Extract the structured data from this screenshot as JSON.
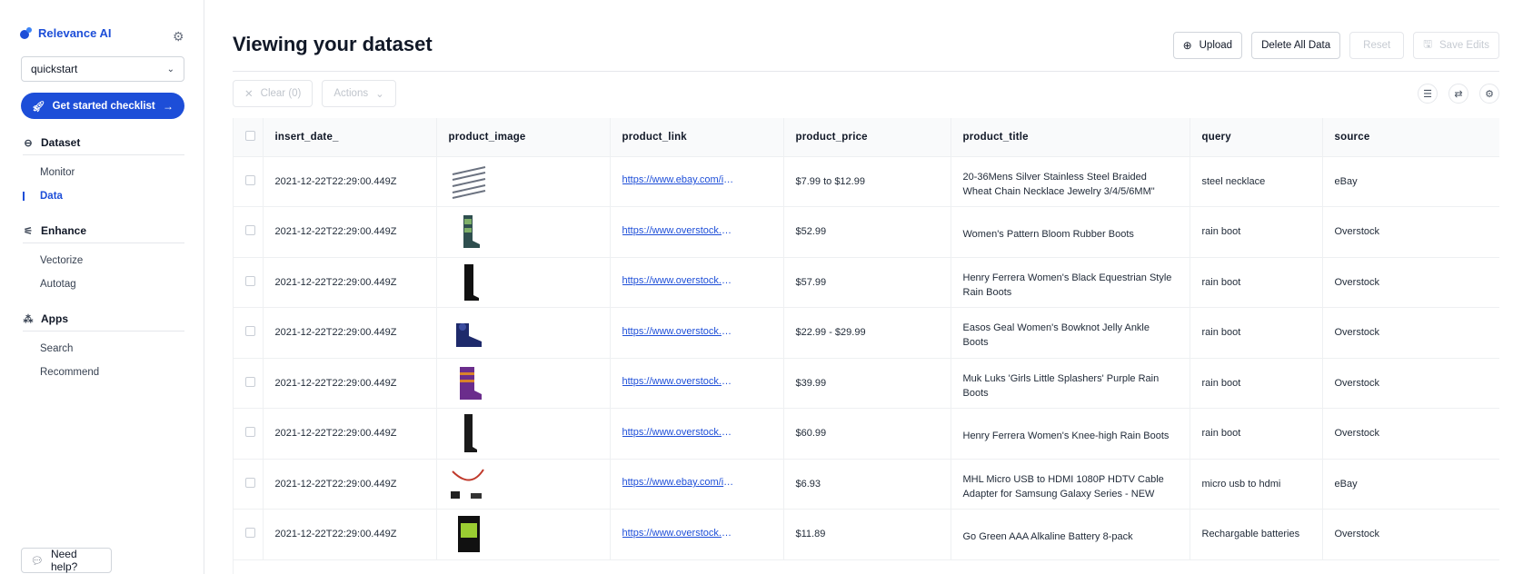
{
  "sidebar": {
    "brand": "Relevance AI",
    "dataset_select": "quickstart",
    "checklist_label": "Get started checklist",
    "sections": [
      {
        "title": "Dataset",
        "items": [
          "Monitor",
          "Data"
        ]
      },
      {
        "title": "Enhance",
        "items": [
          "Vectorize",
          "Autotag"
        ]
      },
      {
        "title": "Apps",
        "items": [
          "Search",
          "Recommend"
        ]
      }
    ],
    "active_item": "Data",
    "help_label": "Need help?"
  },
  "header": {
    "title": "Viewing your dataset",
    "upload": "Upload",
    "delete_all": "Delete All Data",
    "reset": "Reset",
    "save_edits": "Save Edits"
  },
  "toolbar": {
    "clear": "Clear (0)",
    "actions": "Actions"
  },
  "table": {
    "columns": [
      "insert_date_",
      "product_image",
      "product_link",
      "product_price",
      "product_title",
      "query",
      "source"
    ],
    "rows": [
      {
        "date": "2021-12-22T22:29:00.449Z",
        "image": "chain-necklace-image",
        "link": "https://www.ebay.com/itm/...",
        "price": "$7.99 to $12.99",
        "title": "20-36Mens Silver Stainless Steel Braided Wheat Chain Necklace Jewelry 3/4/5/6MM\"",
        "query": "steel necklace",
        "source": "eBay"
      },
      {
        "date": "2021-12-22T22:29:00.449Z",
        "image": "patterned-rain-boot-image",
        "link": "https://www.overstock.com/...",
        "price": "$52.99",
        "title": "Women's Pattern Bloom Rubber Boots",
        "query": "rain boot",
        "source": "Overstock"
      },
      {
        "date": "2021-12-22T22:29:00.449Z",
        "image": "black-riding-boot-image",
        "link": "https://www.overstock.com/...",
        "price": "$57.99",
        "title": "Henry Ferrera Women's Black Equestrian Style Rain Boots",
        "query": "rain boot",
        "source": "Overstock"
      },
      {
        "date": "2021-12-22T22:29:00.449Z",
        "image": "bowknot-ankle-boot-image",
        "link": "https://www.overstock.com/...",
        "price": "$22.99 - $29.99",
        "title": "Easos Geal Women's Bowknot Jelly Ankle Boots",
        "query": "rain boot",
        "source": "Overstock"
      },
      {
        "date": "2021-12-22T22:29:00.449Z",
        "image": "purple-striped-boot-image",
        "link": "https://www.overstock.com/...",
        "price": "$39.99",
        "title": "Muk Luks 'Girls Little Splashers' Purple Rain Boots",
        "query": "rain boot",
        "source": "Overstock"
      },
      {
        "date": "2021-12-22T22:29:00.449Z",
        "image": "knee-high-boot-image",
        "link": "https://www.overstock.com/...",
        "price": "$60.99",
        "title": "Henry Ferrera Women's Knee-high Rain Boots",
        "query": "rain boot",
        "source": "Overstock"
      },
      {
        "date": "2021-12-22T22:29:00.449Z",
        "image": "hdmi-cable-image",
        "link": "https://www.ebay.com/itm/...",
        "price": "$6.93",
        "title": "MHL Micro USB to HDMI 1080P HDTV Cable Adapter for Samsung Galaxy Series - NEW",
        "query": "micro usb to hdmi",
        "source": "eBay"
      },
      {
        "date": "2021-12-22T22:29:00.449Z",
        "image": "aaa-battery-pack-image",
        "link": "https://www.overstock.com/...",
        "price": "$11.89",
        "title": "Go Green AAA Alkaline Battery 8-pack",
        "query": "Rechargable batteries",
        "source": "Overstock"
      }
    ]
  }
}
